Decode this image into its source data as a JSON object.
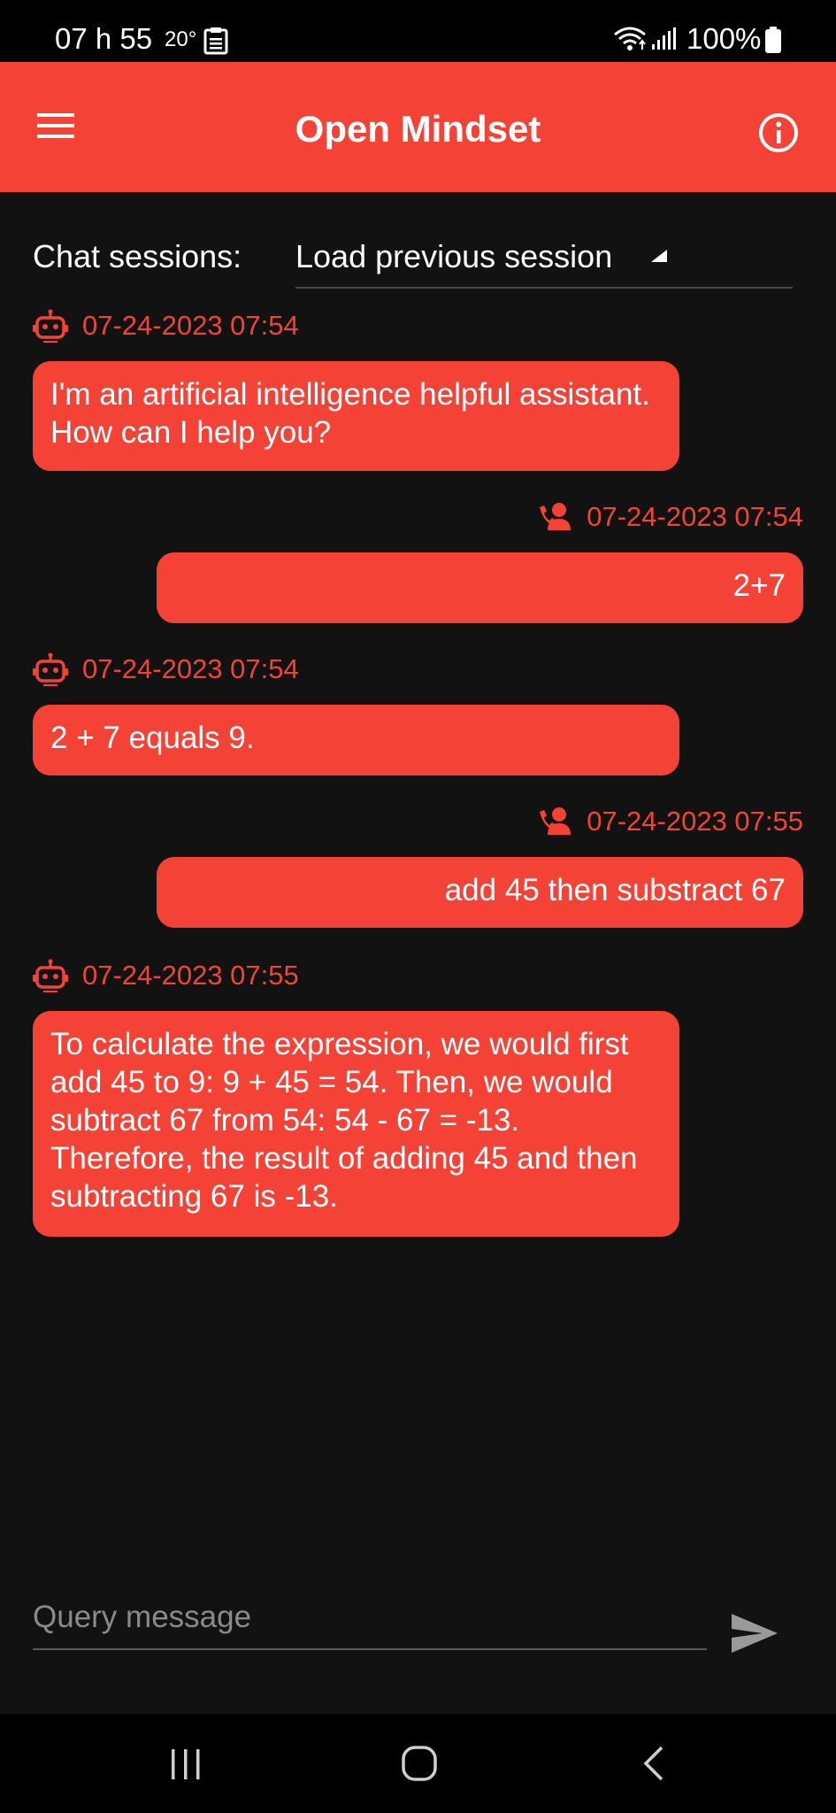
{
  "status_bar": {
    "time": "07 h 55",
    "temperature": "20°",
    "battery": "100%"
  },
  "app_bar": {
    "title": "Open Mindset"
  },
  "sessions": {
    "label": "Chat sessions:",
    "selected": "Load previous session"
  },
  "messages": [
    {
      "sender": "bot",
      "timestamp": "07-24-2023 07:54",
      "text": "I'm an artificial intelligence helpful assistant. How can I help you?"
    },
    {
      "sender": "user",
      "timestamp": "07-24-2023 07:54",
      "text": "2+7"
    },
    {
      "sender": "bot",
      "timestamp": "07-24-2023 07:54",
      "text": "2 + 7 equals 9."
    },
    {
      "sender": "user",
      "timestamp": "07-24-2023 07:55",
      "text": "add 45 then substract 67"
    },
    {
      "sender": "bot",
      "timestamp": "07-24-2023 07:55",
      "text": "To calculate the expression, we would first add 45 to 9: 9 + 45 = 54. Then, we would subtract 67 from 54: 54 - 67 = -13. Therefore, the result of adding 45 and then subtracting 67 is -13."
    }
  ],
  "input": {
    "placeholder": "Query message",
    "value": ""
  },
  "icons": {
    "menu": "menu-icon",
    "info": "info-icon",
    "bot": "robot-icon",
    "user": "user-call-icon",
    "send": "send-icon"
  },
  "colors": {
    "accent": "#f44336",
    "background": "#121212",
    "bars": "#000000"
  }
}
